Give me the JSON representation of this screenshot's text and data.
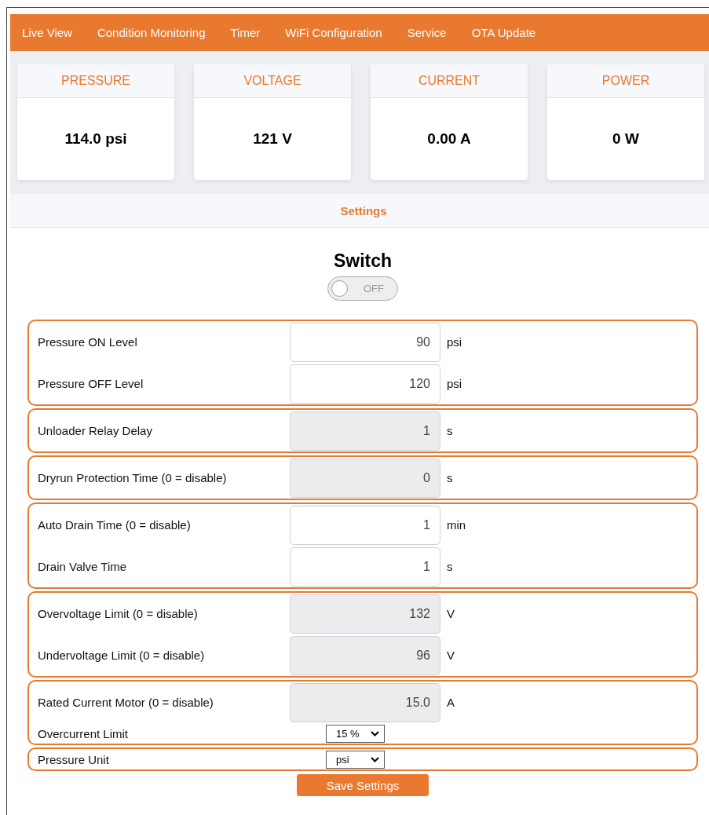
{
  "nav": [
    {
      "label": "Live View"
    },
    {
      "label": "Condition Monitoring"
    },
    {
      "label": "Timer"
    },
    {
      "label": "WiFi Configuration"
    },
    {
      "label": "Service"
    },
    {
      "label": "OTA Update"
    }
  ],
  "cards": [
    {
      "label": "PRESSURE",
      "value": "114.0 psi"
    },
    {
      "label": "VOLTAGE",
      "value": "121 V"
    },
    {
      "label": "CURRENT",
      "value": "0.00 A"
    },
    {
      "label": "POWER",
      "value": "0 W"
    }
  ],
  "settings": {
    "title": "Settings",
    "switch": {
      "title": "Switch",
      "on": false,
      "state_label": "OFF"
    },
    "groups": [
      {
        "rows": [
          {
            "kind": "input",
            "label": "Pressure ON Level",
            "value": "90",
            "unit": "psi",
            "disabled": false
          },
          {
            "kind": "input",
            "label": "Pressure OFF Level",
            "value": "120",
            "unit": "psi",
            "disabled": false
          }
        ]
      },
      {
        "rows": [
          {
            "kind": "input",
            "label": "Unloader Relay Delay",
            "value": "1",
            "unit": "s",
            "disabled": true
          }
        ]
      },
      {
        "rows": [
          {
            "kind": "input",
            "label": "Dryrun Protection Time (0 = disable)",
            "value": "0",
            "unit": "s",
            "disabled": true
          }
        ]
      },
      {
        "rows": [
          {
            "kind": "input",
            "label": "Auto Drain Time (0 = disable)",
            "value": "1",
            "unit": "min",
            "disabled": false
          },
          {
            "kind": "input",
            "label": "Drain Valve Time",
            "value": "1",
            "unit": "s",
            "disabled": false
          }
        ]
      },
      {
        "rows": [
          {
            "kind": "input",
            "label": "Overvoltage Limit (0 = disable)",
            "value": "132",
            "unit": "V",
            "disabled": true
          },
          {
            "kind": "input",
            "label": "Undervoltage Limit (0 = disable)",
            "value": "96",
            "unit": "V",
            "disabled": true
          }
        ]
      },
      {
        "rows": [
          {
            "kind": "input",
            "label": "Rated Current Motor (0 = disable)",
            "value": "15.0",
            "unit": "A",
            "disabled": true
          },
          {
            "kind": "select",
            "label": "Overcurrent Limit",
            "value": "15 %"
          }
        ]
      },
      {
        "rows": [
          {
            "kind": "select",
            "label": "Pressure Unit",
            "value": "psi"
          }
        ]
      }
    ],
    "save_button": "Save Settings"
  }
}
